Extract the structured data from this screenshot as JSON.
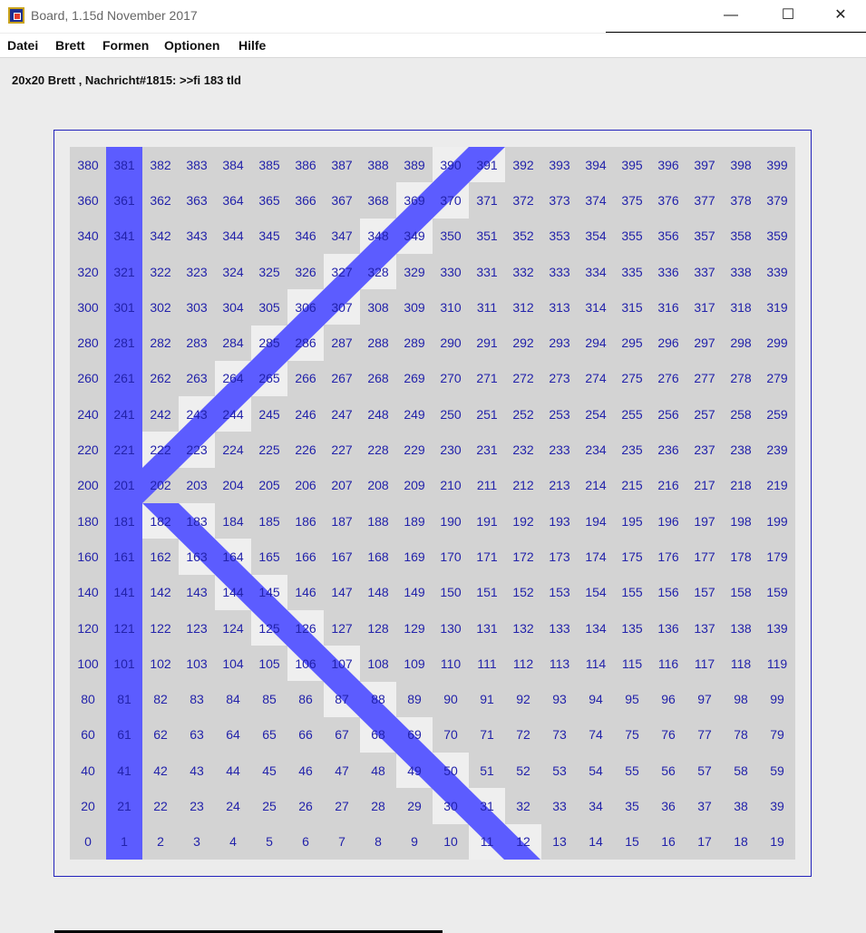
{
  "window": {
    "title": "Board, 1.15d November 2017",
    "minimize_glyph": "—",
    "maximize_glyph": "☐",
    "close_glyph": "✕"
  },
  "menu": {
    "items": [
      "Datei",
      "Brett",
      "Formen",
      "Optionen",
      "Hilfe"
    ]
  },
  "status": {
    "text": "20x20 Brett , Nachricht#1815: >>fi 183 tld"
  },
  "board": {
    "rows": 20,
    "cols": 20,
    "numbering": "row-major from bottom-left, starting at 0",
    "highlighted_cells": [
      1,
      21,
      41,
      61,
      81,
      101,
      121,
      141,
      161,
      181,
      201,
      221,
      241,
      261,
      281,
      301,
      321,
      341,
      361,
      381,
      222,
      223,
      243,
      244,
      264,
      265,
      285,
      286,
      306,
      307,
      327,
      328,
      348,
      349,
      369,
      370,
      390,
      391,
      182,
      183,
      163,
      164,
      144,
      145,
      125,
      126,
      106,
      107,
      87,
      88,
      68,
      69,
      49,
      50,
      30,
      31,
      11,
      12
    ],
    "shape_color": "#5c5cff",
    "cell_text_color": "#2222aa",
    "board_color": "#d3d3d3",
    "light_cell_color": "#efefef",
    "frame_color": "#2222bb"
  }
}
